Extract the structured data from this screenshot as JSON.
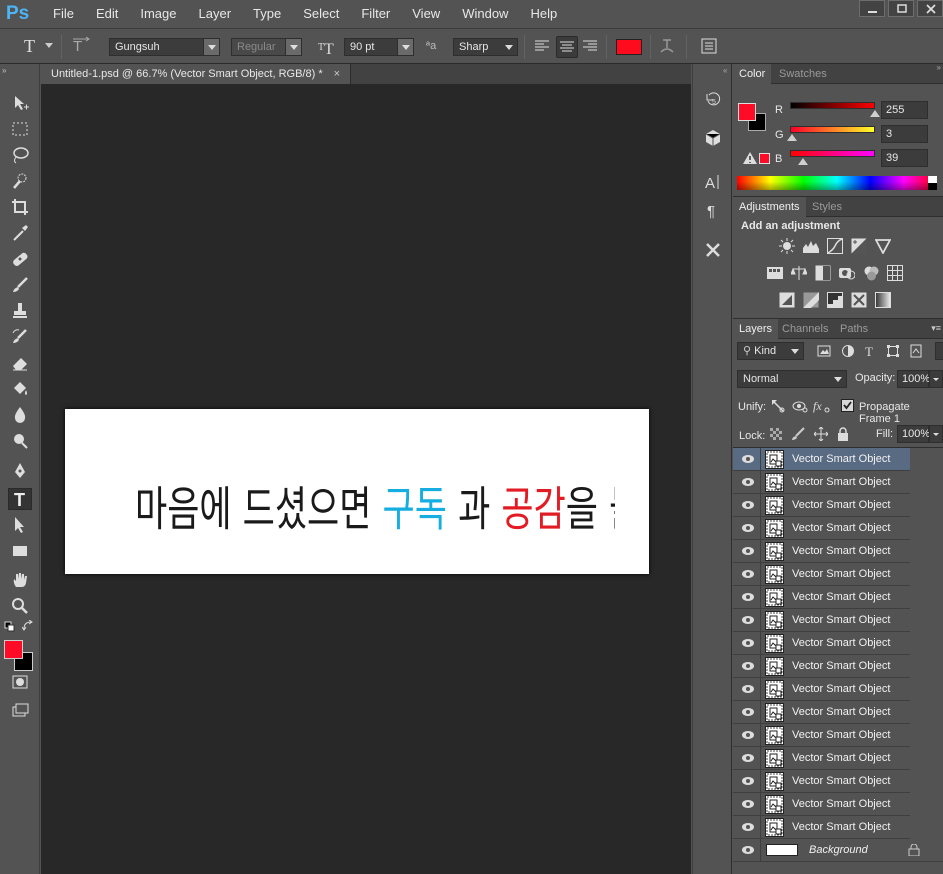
{
  "app": {
    "logo": "Ps"
  },
  "menu": [
    "File",
    "Edit",
    "Image",
    "Layer",
    "Type",
    "Select",
    "Filter",
    "View",
    "Window",
    "Help"
  ],
  "options": {
    "font_family": "Gungsuh",
    "font_style": "Regular",
    "font_size": "90 pt",
    "aa_label": "ªa",
    "antialias": "Sharp",
    "text_color": "#ff0b1e"
  },
  "document": {
    "tab_title": "Untitled-1.psd @ 66.7% (Vector Smart Object, RGB/8) *",
    "close": "×",
    "banner_segments": [
      {
        "text": "마음에 드셨으면 ",
        "color": "#1a1a1a"
      },
      {
        "text": "구독",
        "color": "#16aee0"
      },
      {
        "text": " 과 ",
        "color": "#1a1a1a"
      },
      {
        "text": "공감",
        "color": "#e31b23"
      },
      {
        "text": "을 눌러주세요",
        "color": "#1a1a1a"
      },
      {
        "text": "!",
        "color": "#1a1a1a"
      }
    ]
  },
  "color_panel": {
    "tabs": [
      "Color",
      "Swatches"
    ],
    "fg": "#ff0b27",
    "bg": "#000000",
    "r_label": "R",
    "r": "255",
    "g_label": "G",
    "g": "3",
    "b_label": "B",
    "b": "39"
  },
  "adjustments_panel": {
    "tabs": [
      "Adjustments",
      "Styles"
    ],
    "heading": "Add an adjustment"
  },
  "layers_panel": {
    "tabs": [
      "Layers",
      "Channels",
      "Paths"
    ],
    "filter_kind": "Kind",
    "blend_mode": "Normal",
    "opacity_label": "Opacity:",
    "opacity": "100%",
    "unify_label": "Unify:",
    "propagate": "Propagate Frame 1",
    "lock_label": "Lock:",
    "fill_label": "Fill:",
    "fill": "100%",
    "layers": [
      {
        "name": "Vector Smart Object",
        "selected": true
      },
      {
        "name": "Vector Smart Object"
      },
      {
        "name": "Vector Smart Object"
      },
      {
        "name": "Vector Smart Object"
      },
      {
        "name": "Vector Smart Object"
      },
      {
        "name": "Vector Smart Object"
      },
      {
        "name": "Vector Smart Object"
      },
      {
        "name": "Vector Smart Object"
      },
      {
        "name": "Vector Smart Object"
      },
      {
        "name": "Vector Smart Object"
      },
      {
        "name": "Vector Smart Object"
      },
      {
        "name": "Vector Smart Object"
      },
      {
        "name": "Vector Smart Object"
      },
      {
        "name": "Vector Smart Object"
      },
      {
        "name": "Vector Smart Object"
      },
      {
        "name": "Vector Smart Object"
      },
      {
        "name": "Vector Smart Object"
      },
      {
        "name": "Background",
        "background": true
      }
    ]
  }
}
